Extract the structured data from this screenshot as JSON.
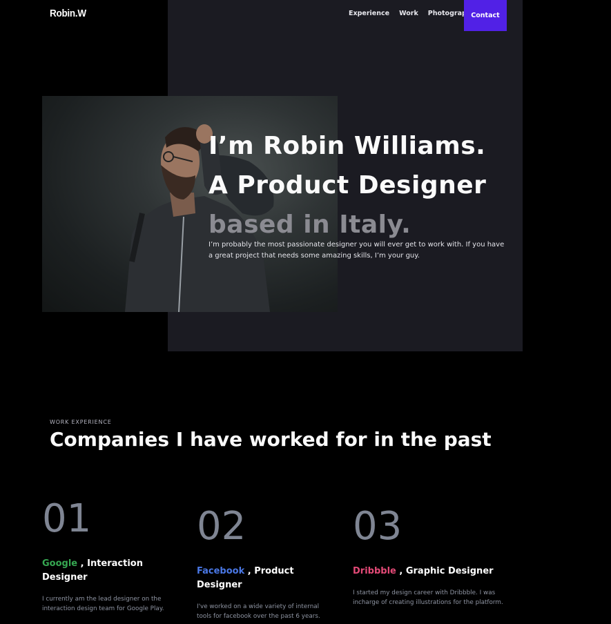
{
  "header": {
    "logo": "Robin.W",
    "nav": [
      "Experience",
      "Work",
      "Photography"
    ],
    "contact": "Contact"
  },
  "hero": {
    "line1": "I’m Robin Williams.",
    "line2": "A Product Designer",
    "line3": "based in Italy.",
    "description": "I’m probably the most passionate designer you will ever get to work with. If you have a great project that needs some amazing skills, I’m your guy."
  },
  "experience": {
    "label": "WORK EXPERIENCE",
    "title": "Companies I have worked for in the past",
    "jobs": [
      {
        "number": "01",
        "company": "Google",
        "role": " , Interaction Designer",
        "description": "I currently am the lead designer on the interaction design team for Google Play."
      },
      {
        "number": "02",
        "company": "Facebook",
        "role": " , Product Designer",
        "description": "I've worked on a wide variety of internal tools for facebook over the past 6 years."
      },
      {
        "number": "03",
        "company": "Dribbble",
        "role": " , Graphic Designer",
        "description": "I started my design career with Dribbble. I was incharge of creating illustrations for the platform."
      }
    ]
  },
  "colors": {
    "accent": "#5121e6",
    "google": "#36a852",
    "facebook": "#4a78e6",
    "dribbble": "#e44a77"
  }
}
